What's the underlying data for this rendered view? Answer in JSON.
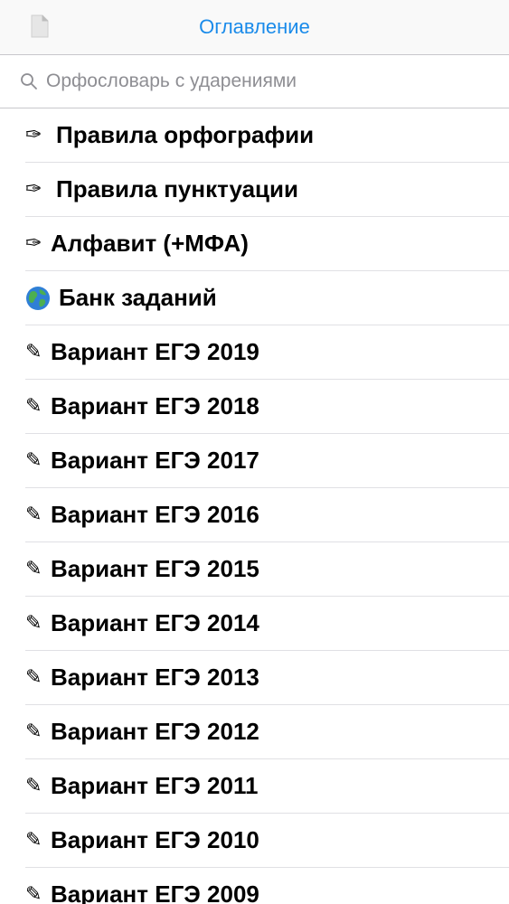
{
  "nav": {
    "title": "Оглавление",
    "left_icon": "document-icon",
    "title_color": "#1a8bea"
  },
  "search": {
    "placeholder": "Орфословарь с ударениями",
    "icon": "search-icon"
  },
  "toc": {
    "items": [
      {
        "icon": "pen-nib-icon",
        "glyph": "✑",
        "label": "Правила орфографии"
      },
      {
        "icon": "pen-nib-icon",
        "glyph": "✑",
        "label": "Правила пунктуации"
      },
      {
        "icon": "pen-nib-icon",
        "glyph": "✑",
        "label": "Алфавит (+МФА)"
      },
      {
        "icon": "globe-icon",
        "glyph": "",
        "label": "Банк заданий"
      },
      {
        "icon": "pencil-icon",
        "glyph": "✎",
        "label": "Вариант ЕГЭ 2019"
      },
      {
        "icon": "pencil-icon",
        "glyph": "✎",
        "label": "Вариант ЕГЭ 2018"
      },
      {
        "icon": "pencil-icon",
        "glyph": "✎",
        "label": "Вариант ЕГЭ 2017"
      },
      {
        "icon": "pencil-icon",
        "glyph": "✎",
        "label": "Вариант ЕГЭ 2016"
      },
      {
        "icon": "pencil-icon",
        "glyph": "✎",
        "label": "Вариант ЕГЭ 2015"
      },
      {
        "icon": "pencil-icon",
        "glyph": "✎",
        "label": "Вариант ЕГЭ 2014"
      },
      {
        "icon": "pencil-icon",
        "glyph": "✎",
        "label": "Вариант ЕГЭ 2013"
      },
      {
        "icon": "pencil-icon",
        "glyph": "✎",
        "label": "Вариант ЕГЭ 2012"
      },
      {
        "icon": "pencil-icon",
        "glyph": "✎",
        "label": "Вариант ЕГЭ 2011"
      },
      {
        "icon": "pencil-icon",
        "glyph": "✎",
        "label": "Вариант ЕГЭ 2010"
      },
      {
        "icon": "pencil-icon",
        "glyph": "✎",
        "label": "Вариант ЕГЭ 2009"
      }
    ]
  }
}
